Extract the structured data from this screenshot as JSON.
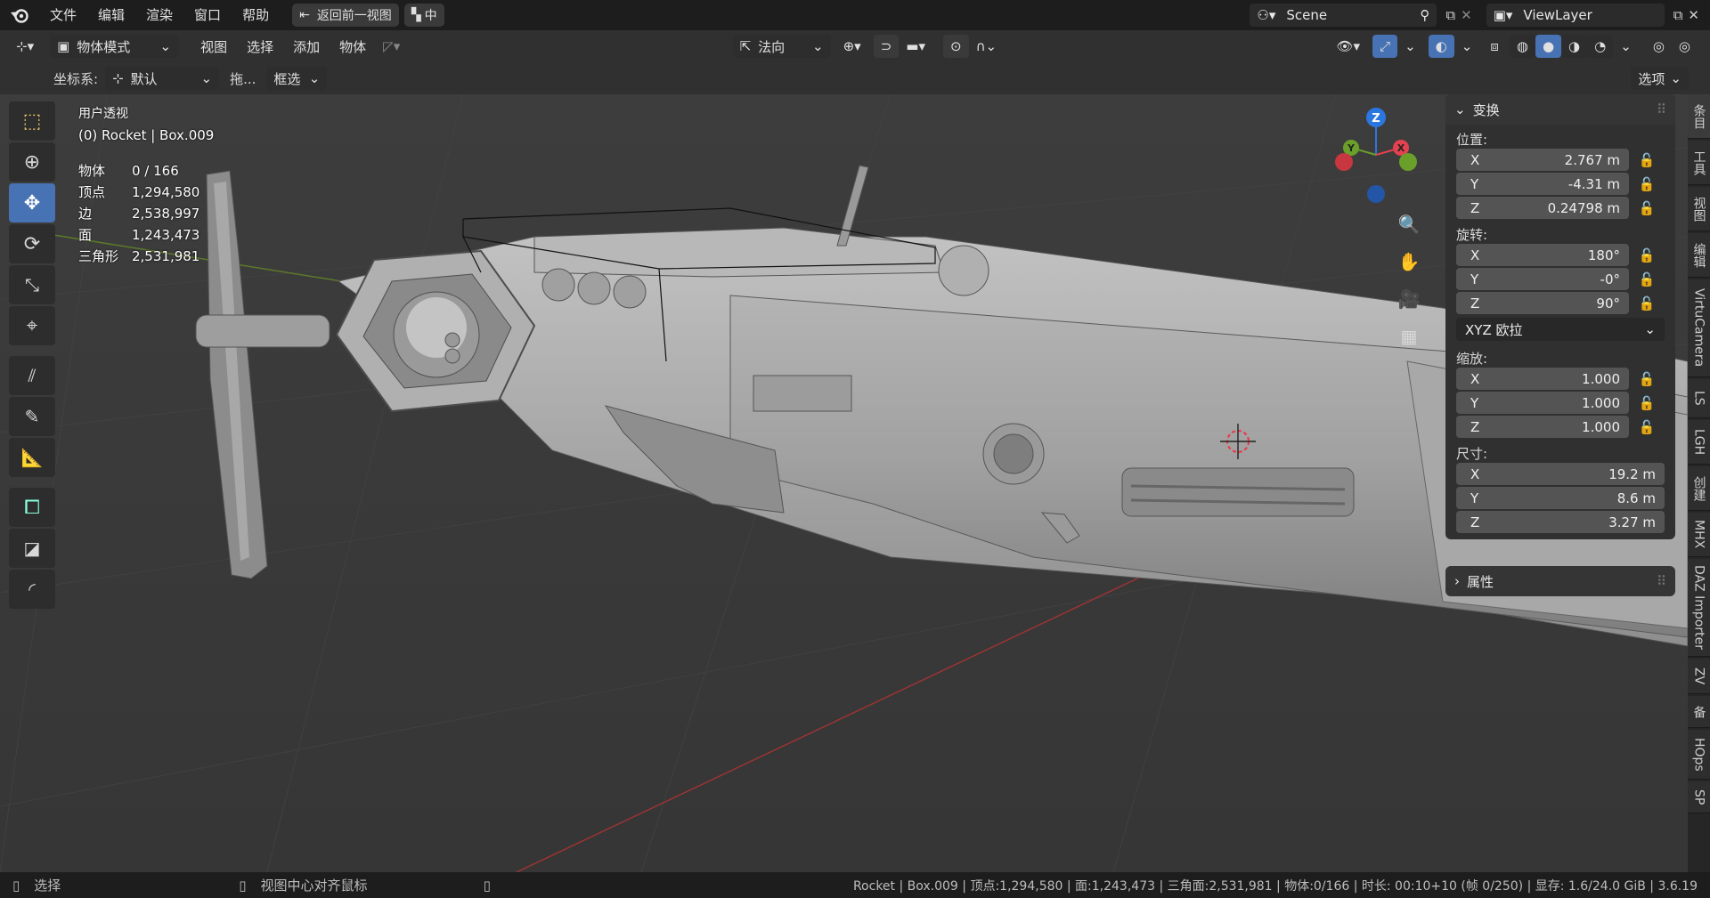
{
  "topbar": {
    "menus": [
      "文件",
      "编辑",
      "渲染",
      "窗口",
      "帮助"
    ],
    "back_button": "返回前一视图",
    "lang_button": "中",
    "scene": "Scene",
    "viewlayer": "ViewLayer"
  },
  "header": {
    "mode": "物体模式",
    "menus": [
      "视图",
      "选择",
      "添加",
      "物体"
    ],
    "orientation": "法向",
    "options": "选项"
  },
  "header2": {
    "coord_label": "坐标系:",
    "coord_value": "默认",
    "drag_label": "拖...",
    "select_value": "框选"
  },
  "viewport_info": {
    "view_name": "用户透视",
    "object_name": "(0) Rocket | Box.009",
    "stats": [
      {
        "label": "物体",
        "value": "0 / 166"
      },
      {
        "label": "顶点",
        "value": "1,294,580"
      },
      {
        "label": "边",
        "value": "2,538,997"
      },
      {
        "label": "面",
        "value": "1,243,473"
      },
      {
        "label": "三角形",
        "value": "2,531,981"
      }
    ]
  },
  "gizmo": {
    "x": "X",
    "y": "Y",
    "z": "Z"
  },
  "transform": {
    "title": "变换",
    "location_label": "位置:",
    "location": [
      {
        "axis": "X",
        "value": "2.767 m"
      },
      {
        "axis": "Y",
        "value": "-4.31 m"
      },
      {
        "axis": "Z",
        "value": "0.24798 m"
      }
    ],
    "rotation_label": "旋转:",
    "rotation": [
      {
        "axis": "X",
        "value": "180°"
      },
      {
        "axis": "Y",
        "value": "-0°"
      },
      {
        "axis": "Z",
        "value": "90°"
      }
    ],
    "rotation_mode": "XYZ 欧拉",
    "scale_label": "缩放:",
    "scale": [
      {
        "axis": "X",
        "value": "1.000"
      },
      {
        "axis": "Y",
        "value": "1.000"
      },
      {
        "axis": "Z",
        "value": "1.000"
      }
    ],
    "dimensions_label": "尺寸:",
    "dimensions": [
      {
        "axis": "X",
        "value": "19.2 m"
      },
      {
        "axis": "Y",
        "value": "8.6 m"
      },
      {
        "axis": "Z",
        "value": "3.27 m"
      }
    ]
  },
  "properties": {
    "title": "属性"
  },
  "sidetabs": [
    "条目",
    "工具",
    "视图",
    "编辑",
    "VirtuCamera",
    "LS",
    "LGH",
    "创建",
    "MHX",
    "DAZ Importer",
    "ZV",
    "备",
    "HOps",
    "SP"
  ],
  "statusbar": {
    "left_action": "选择",
    "middle_action": "视图中心对齐鼠标",
    "info": "Rocket | Box.009 | 顶点:1,294,580 | 面:1,243,473 | 三角面:2,531,981 | 物体:0/166 | 时长: 00:10+10 (帧 0/250) | 显存: 1.6/24.0 GiB | 3.6.19"
  },
  "colors": {
    "accent": "#4772b3",
    "x_axis": "#e2414f",
    "y_axis": "#6aa02a",
    "z_axis": "#2b77e1"
  }
}
